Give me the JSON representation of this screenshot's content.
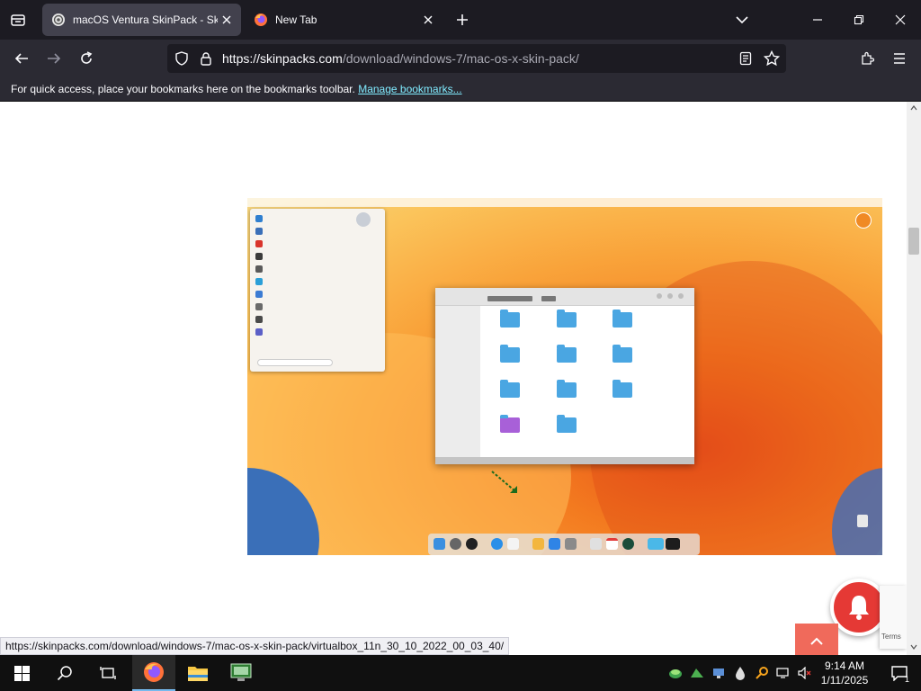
{
  "browser": {
    "tabs": [
      {
        "title": "macOS Ventura SkinPack - SkinPack",
        "active": true
      },
      {
        "title": "New Tab",
        "active": false
      }
    ],
    "url": {
      "host": "https://skinpacks.com",
      "path": "/download/windows-7/mac-os-x-skin-pack/"
    },
    "bookmarks_bar": {
      "message": "For quick access, place your bookmarks here on the bookmarks toolbar.",
      "link": "Manage bookmarks..."
    },
    "status_url": "https://skinpacks.com/download/windows-7/mac-os-x-skin-pack/virtualbox_11n_30_10_2022_00_03_40/"
  },
  "page": {
    "recaptcha_text": "Terms"
  },
  "taskbar": {
    "time": "9:14 AM",
    "date": "1/11/2025",
    "notification_count": "1"
  },
  "colors": {
    "tabbar_bg": "#1c1b22",
    "toolbar_bg": "#2b2a33",
    "link": "#80ebff",
    "bell": "#e53935",
    "to_top": "#f06a5b",
    "taskbar_bg": "#101010"
  }
}
